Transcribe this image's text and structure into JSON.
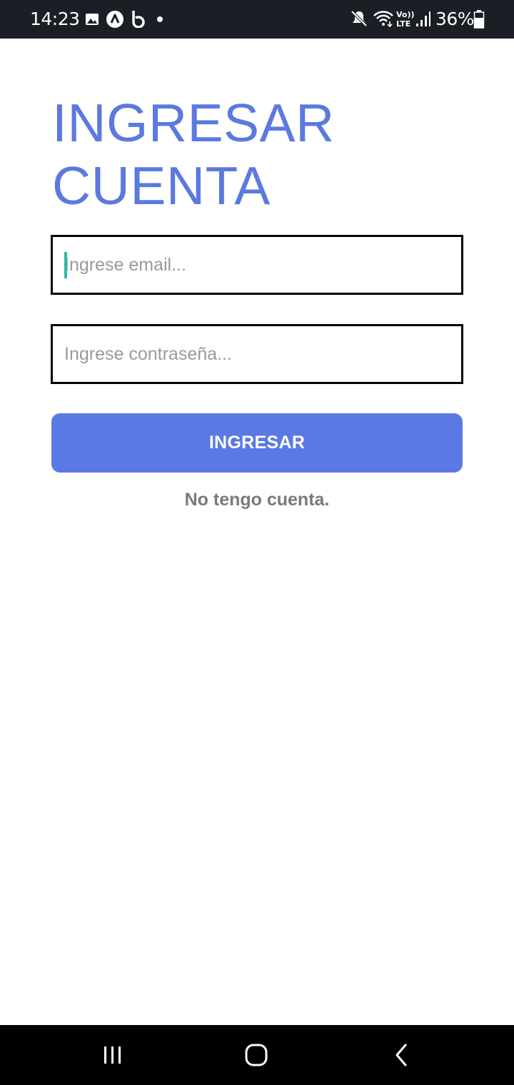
{
  "status_bar": {
    "time": "14:23",
    "battery_percent": "36%",
    "icons": [
      "gallery-icon",
      "a-logo-icon",
      "b-logo-icon",
      "dot-icon",
      "mute-icon",
      "wifi-icon",
      "volte-icon",
      "signal-icon",
      "battery-icon"
    ]
  },
  "login": {
    "title_line1": "INGRESAR",
    "title_line2": "CUENTA",
    "email_placeholder": "Ingrese email...",
    "email_value": "",
    "password_placeholder": "Ingrese contraseña...",
    "password_value": "",
    "submit_label": "INGRESAR",
    "register_link": "No tengo cuenta."
  },
  "nav_bar": {
    "icons": [
      "recents-icon",
      "home-icon",
      "back-icon"
    ]
  },
  "colors": {
    "accent": "#5b79e4",
    "title": "#5b79df",
    "status_bar_bg": "#1b1e25",
    "caret": "#2bb8a6",
    "link_text": "#7a7a7a"
  }
}
